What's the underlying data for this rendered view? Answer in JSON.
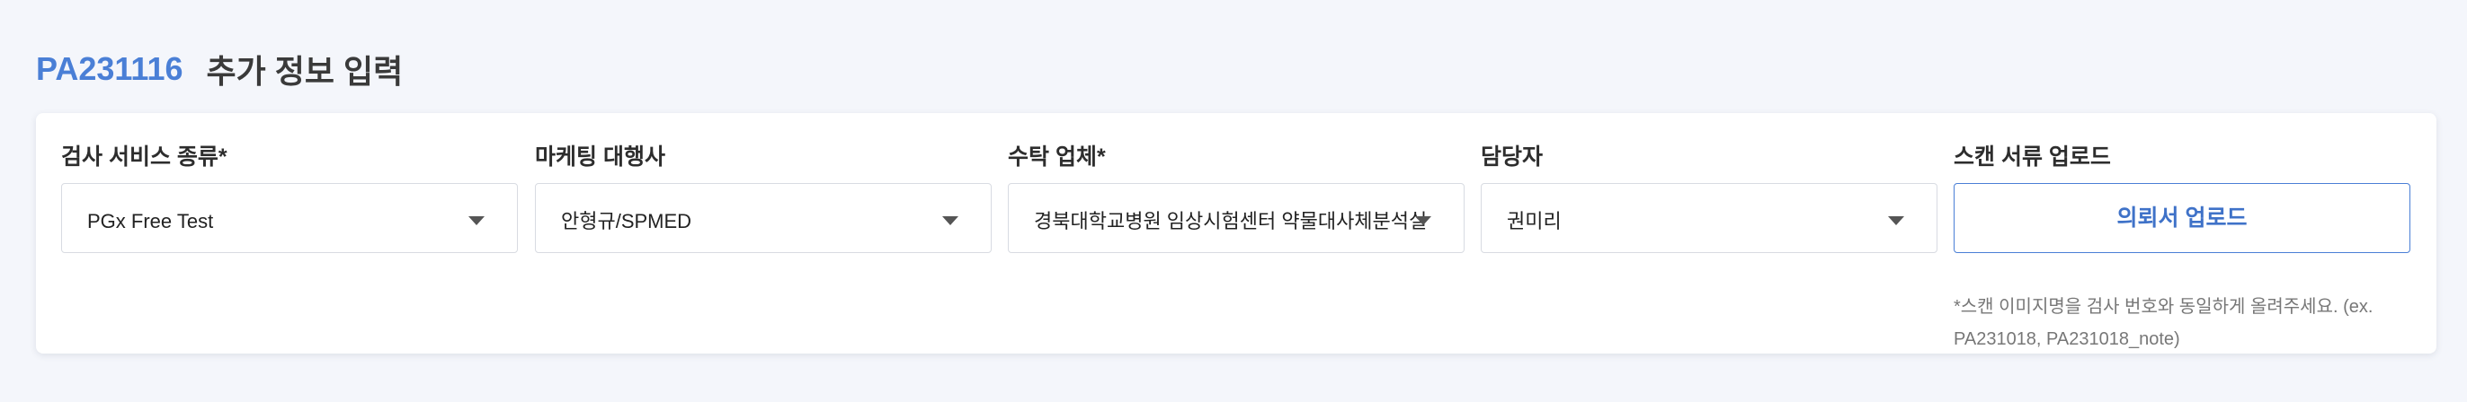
{
  "header": {
    "code": "PA231116",
    "title": "추가 정보 입력"
  },
  "form": {
    "test_service": {
      "label": "검사 서비스 종류*",
      "value": "PGx Free Test"
    },
    "marketing_agency": {
      "label": "마케팅 대행사",
      "value": "안형규/SPMED"
    },
    "contractor": {
      "label": "수탁 업체*",
      "value": "경북대학교병원 임상시험센터 약물대사체분석실"
    },
    "manager": {
      "label": "담당자",
      "value": "권미리"
    },
    "scan_upload": {
      "label": "스캔 서류 업로드",
      "button_label": "의뢰서 업로드",
      "note": "*스캔 이미지명을 검사 번호와 동일하게 올려주세요. (ex. PA231018, PA231018_note)"
    }
  },
  "icons": {
    "select_caret": "caret-down-icon"
  },
  "colors": {
    "accent": "#4a7fd6",
    "background": "#f4f6fb",
    "card": "#ffffff"
  }
}
